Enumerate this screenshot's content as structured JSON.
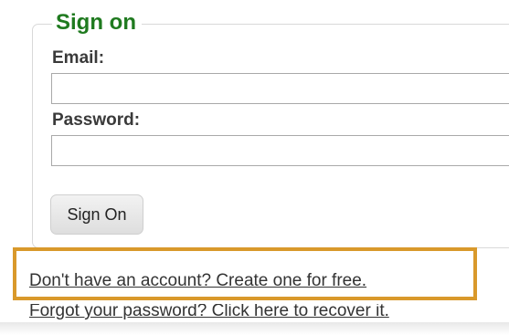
{
  "form": {
    "legend": "Sign on",
    "email_label": "Email:",
    "email_value": "",
    "password_label": "Password:",
    "password_value": "",
    "submit_label": "Sign On"
  },
  "links": {
    "create_account": "Don't have an account? Create one for free.",
    "forgot_password": "Forgot your password? Click here to recover it."
  },
  "colors": {
    "legend": "#1f7a1f",
    "highlight": "#d9992b"
  }
}
